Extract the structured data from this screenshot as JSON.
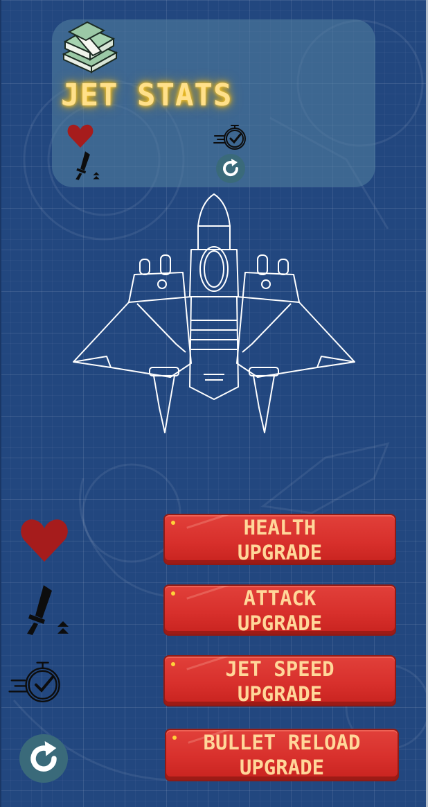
{
  "stats_panel": {
    "title": "JET STATS"
  },
  "upgrades": [
    {
      "label_line1": "HEALTH",
      "label_line2": "UPGRADE",
      "icon": "heart-icon"
    },
    {
      "label_line1": "ATTACK",
      "label_line2": "UPGRADE",
      "icon": "sword-icon"
    },
    {
      "label_line1": "JET SPEED",
      "label_line2": "UPGRADE",
      "icon": "speed-stopwatch-icon"
    },
    {
      "label_line1": "BULLET RELOAD",
      "label_line2": "UPGRADE",
      "icon": "reload-icon"
    }
  ],
  "colors": {
    "background": "#22477f",
    "panel": "#5482a0",
    "title": "#ffe08a",
    "button": "#d8302c",
    "button_text": "#ffd79a",
    "heart": "#a61c1c"
  }
}
